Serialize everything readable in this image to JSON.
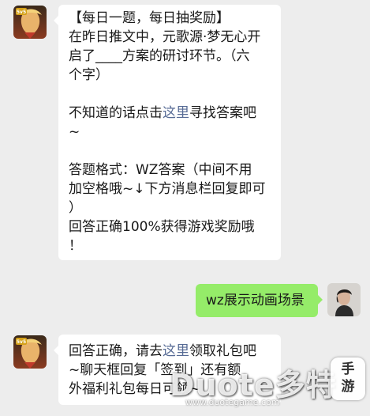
{
  "messages": [
    {
      "side": "left",
      "sender": "game-official",
      "lines": [
        "【每日一题，每日抽奖励】",
        "在昨日推文中，元歌源·梦无心开",
        "启了____方案的研讨环节。（六",
        "个字）",
        "",
        "不知道的话点击|这里|寻找答案吧",
        "~",
        "",
        "答题格式：WZ答案（中间不用",
        "加空格哦~↓下方消息栏回复即可",
        "）",
        "回答正确100%获得游戏奖励哦",
        "！"
      ]
    },
    {
      "side": "right",
      "sender": "user",
      "lines": [
        "wz展示动画场景"
      ]
    },
    {
      "side": "left",
      "sender": "game-official",
      "lines": [
        "回答正确，请去这里领取礼包吧",
        "~聊天框回复「签到」还有额",
        "外福利礼包每日可领~"
      ]
    }
  ],
  "msg1": {
    "l1": "【每日一题，每日抽奖励】",
    "l2": "在昨日推文中，元歌源·梦无心开",
    "l3": "启了____方案的研讨环节。（六",
    "l4": "个字）",
    "l5a": "不知道的话点击",
    "l5link": "这里",
    "l5b": "寻找答案吧",
    "l6": "~",
    "l7": "答题格式：WZ答案（中间不用",
    "l8": "加空格哦~↓下方消息栏回复即可",
    "l9": "）",
    "l10": "回答正确100%获得游戏奖励哦",
    "l11": "！"
  },
  "msg2": {
    "l1": "wz展示动画场景"
  },
  "msg3": {
    "l1a": "回答正确，请去",
    "l1link": "这里",
    "l1b": "领取礼包吧",
    "l2": "~聊天框回复「签到」还有额",
    "l3": "外福利礼包每日可领~"
  },
  "avatar_badge": "5v5",
  "watermark": {
    "brand": "Duote多特",
    "badge": "手游",
    "url": "www.duotegame.com"
  },
  "colors": {
    "background": "#ededed",
    "bubble_received": "#ffffff",
    "bubble_sent": "#95ec69",
    "link": "#576b95",
    "text": "#191919"
  },
  "icons": [
    "game-avatar-icon",
    "user-avatar-icon"
  ]
}
